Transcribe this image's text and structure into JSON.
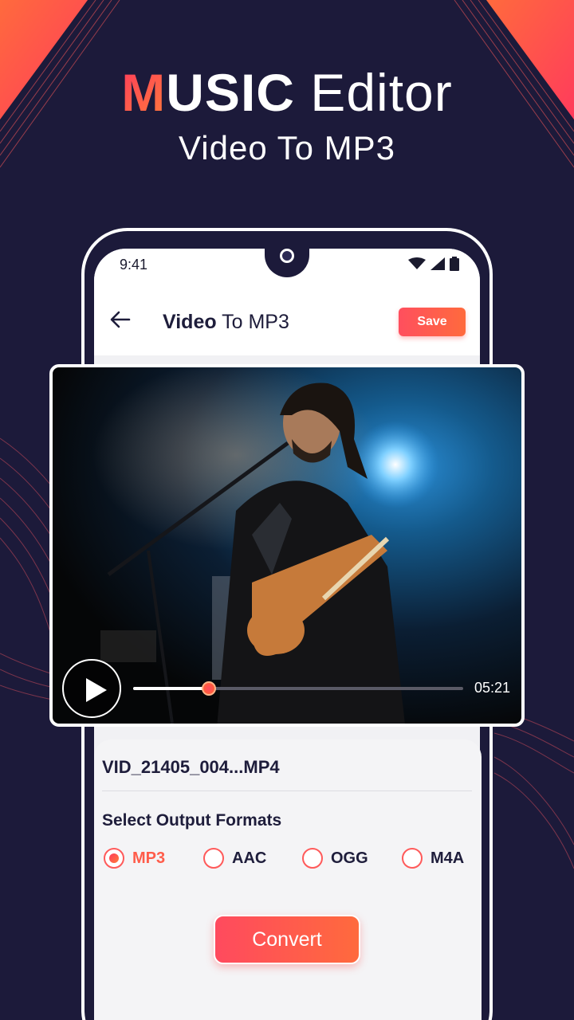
{
  "header": {
    "title_accent_letter": "M",
    "title_rest": "USIC",
    "title_light": "Editor",
    "subtitle": "Video To MP3"
  },
  "status_bar": {
    "time": "9:41"
  },
  "app_bar": {
    "title_bold": "Video",
    "title_rest": "To MP3",
    "save_label": "Save"
  },
  "player": {
    "progress_fraction": 0.23,
    "duration": "05:21"
  },
  "file": {
    "name": "VID_21405_004...MP4"
  },
  "output": {
    "section_title": "Select Output Formats",
    "formats": [
      {
        "label": "MP3",
        "selected": true
      },
      {
        "label": "AAC",
        "selected": false
      },
      {
        "label": "OGG",
        "selected": false
      },
      {
        "label": "M4A",
        "selected": false
      }
    ]
  },
  "convert_label": "Convert",
  "colors": {
    "background": "#1c1a3a",
    "accent_start": "#ff3b5c",
    "accent_end": "#ff7b3a"
  }
}
